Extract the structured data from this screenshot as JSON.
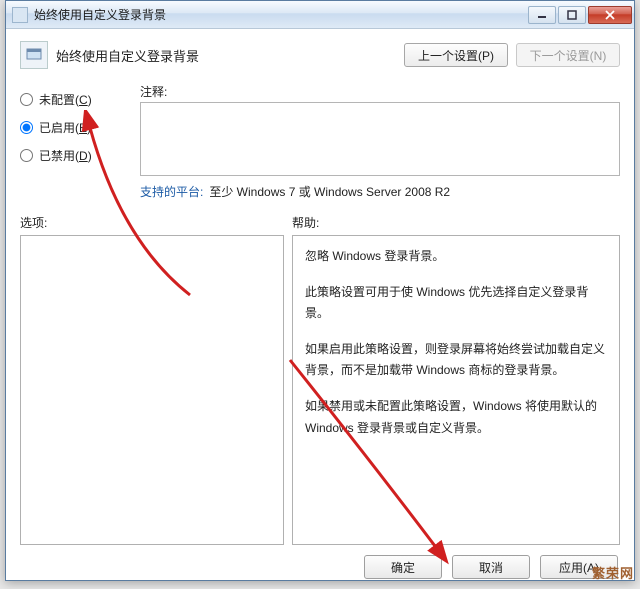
{
  "window": {
    "title": "始终使用自定义登录背景"
  },
  "header": {
    "title": "始终使用自定义登录背景",
    "prev": "上一个设置(P)",
    "next": "下一个设置(N)"
  },
  "radios": {
    "not_configured": {
      "label": "未配置",
      "accel": "C"
    },
    "enabled": {
      "label": "已启用",
      "accel": "E"
    },
    "disabled": {
      "label": "已禁用",
      "accel": "D"
    },
    "selected": "enabled"
  },
  "note": {
    "label": "注释:",
    "value": ""
  },
  "platform": {
    "label": "支持的平台:",
    "value": "至少 Windows 7 或 Windows Server 2008 R2"
  },
  "sections": {
    "options": "选项:",
    "help": "帮助:"
  },
  "help": {
    "p1": "忽略 Windows 登录背景。",
    "p2": "此策略设置可用于使 Windows 优先选择自定义登录背景。",
    "p3": "如果启用此策略设置，则登录屏幕将始终尝试加载自定义背景，而不是加载带 Windows 商标的登录背景。",
    "p4": "如果禁用或未配置此策略设置，Windows 将使用默认的 Windows 登录背景或自定义背景。"
  },
  "buttons": {
    "ok": "确定",
    "cancel": "取消",
    "apply": "应用(A)"
  },
  "watermark": "繁荣网"
}
